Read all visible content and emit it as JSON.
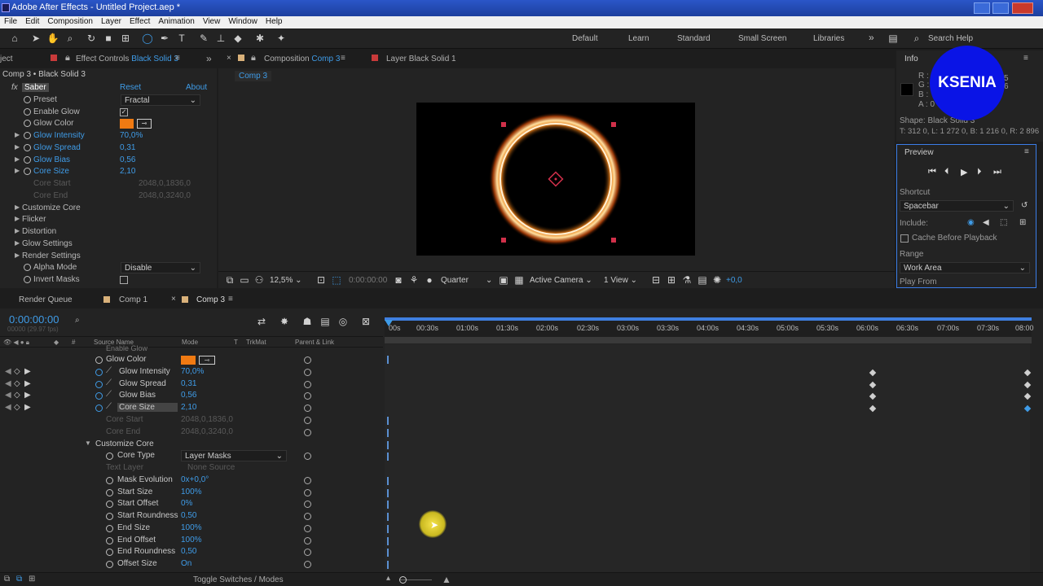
{
  "window": {
    "title": "Adobe After Effects - Untitled Project.aep *"
  },
  "menu": [
    "File",
    "Edit",
    "Composition",
    "Layer",
    "Effect",
    "Animation",
    "View",
    "Window",
    "Help"
  ],
  "workspaces": [
    "Default",
    "Learn",
    "Standard",
    "Small Screen",
    "Libraries"
  ],
  "search_help": "Search Help",
  "effect_controls": {
    "project_tab_fragment": "ject",
    "tab": "Effect Controls",
    "tab_layer": "Black Solid 3",
    "breadcrumb": "Comp 3 • Black Solid 3",
    "effect_name": "Saber",
    "reset": "Reset",
    "about": "About",
    "props": [
      {
        "label": "Preset",
        "value": "Fractal"
      },
      {
        "label": "Enable Glow",
        "value": ""
      },
      {
        "label": "Glow Color",
        "value": ""
      },
      {
        "label": "Glow Intensity",
        "value": "70,0%"
      },
      {
        "label": "Glow Spread",
        "value": "0,31"
      },
      {
        "label": "Glow Bias",
        "value": "0,56"
      },
      {
        "label": "Core Size",
        "value": "2,10"
      },
      {
        "label": "Core Start",
        "value": "2048,0,1836,0"
      },
      {
        "label": "Core End",
        "value": "2048,0,3240,0"
      },
      {
        "label": "Customize Core",
        "value": ""
      },
      {
        "label": "Flicker",
        "value": ""
      },
      {
        "label": "Distortion",
        "value": ""
      },
      {
        "label": "Glow Settings",
        "value": ""
      },
      {
        "label": "Render Settings",
        "value": ""
      },
      {
        "label": "Alpha Mode",
        "value": "Disable"
      },
      {
        "label": "Invert Masks",
        "value": ""
      }
    ]
  },
  "composition": {
    "tab": "Composition",
    "tab_name": "Comp 3",
    "layer_tab": "Layer  Black Solid 1",
    "sub_tab": "Comp 3",
    "zoom": "12,5%",
    "timecode": "0:00:00:00",
    "resolution": "Quarter",
    "camera": "Active Camera",
    "views": "1 View",
    "exposure": "+0,0"
  },
  "info": {
    "title": "Info",
    "channels": [
      "R :",
      "G :",
      "B :",
      "A : 0"
    ],
    "channel_vals": [
      "5",
      "6"
    ],
    "shape": "Shape: Black Solid 3",
    "coords": "T: 312 0, L: 1 272 0, B: 1 216 0, R: 2 896",
    "watermark": "KSENIA"
  },
  "preview": {
    "title": "Preview",
    "shortcut_label": "Shortcut",
    "shortcut": "Spacebar",
    "include": "Include:",
    "cache": "Cache Before Playback",
    "range_label": "Range",
    "range": "Work Area",
    "play_from": "Play From"
  },
  "timeline": {
    "tabs": [
      "Render Queue",
      "Comp 1",
      "Comp 3"
    ],
    "timecode": "0:00:00:00",
    "timecode_sub": "00000 (29.97 fps)",
    "columns": [
      "Source Name",
      "Mode",
      "T",
      "TrkMat",
      "Parent & Link"
    ],
    "ruler": [
      "00s",
      "00:30s",
      "01:00s",
      "01:30s",
      "02:00s",
      "02:30s",
      "03:00s",
      "03:30s",
      "04:00s",
      "04:30s",
      "05:00s",
      "05:30s",
      "06:00s",
      "06:30s",
      "07:00s",
      "07:30s",
      "08:00"
    ],
    "top_partial": "Enable Glow",
    "rows": [
      {
        "label": "Glow Color",
        "value": ""
      },
      {
        "label": "Glow Intensity",
        "value": "70,0%"
      },
      {
        "label": "Glow Spread",
        "value": "0,31"
      },
      {
        "label": "Glow Bias",
        "value": "0,56"
      },
      {
        "label": "Core Size",
        "value": "2,10"
      },
      {
        "label": "Core Start",
        "value": "2048,0,1836,0"
      },
      {
        "label": "Core End",
        "value": "2048,0,3240,0"
      },
      {
        "label": "Customize Core",
        "value": ""
      },
      {
        "label": "Core Type",
        "value": "Layer Masks"
      },
      {
        "label": "Text Layer",
        "value": "None    Source"
      },
      {
        "label": "Mask Evolution",
        "value": "0x+0,0°"
      },
      {
        "label": "Start Size",
        "value": "100%"
      },
      {
        "label": "Start Offset",
        "value": "0%"
      },
      {
        "label": "Start Roundness",
        "value": "0,50"
      },
      {
        "label": "End Size",
        "value": "100%"
      },
      {
        "label": "End Offset",
        "value": "100%"
      },
      {
        "label": "End Roundness",
        "value": "0,50"
      },
      {
        "label": "Offset Size",
        "value": "On"
      }
    ],
    "toggle": "Toggle Switches / Modes"
  },
  "colors": {
    "accent": "#3f9ce8",
    "glow": "#f07a12",
    "title_bar": "#2a56c8"
  }
}
